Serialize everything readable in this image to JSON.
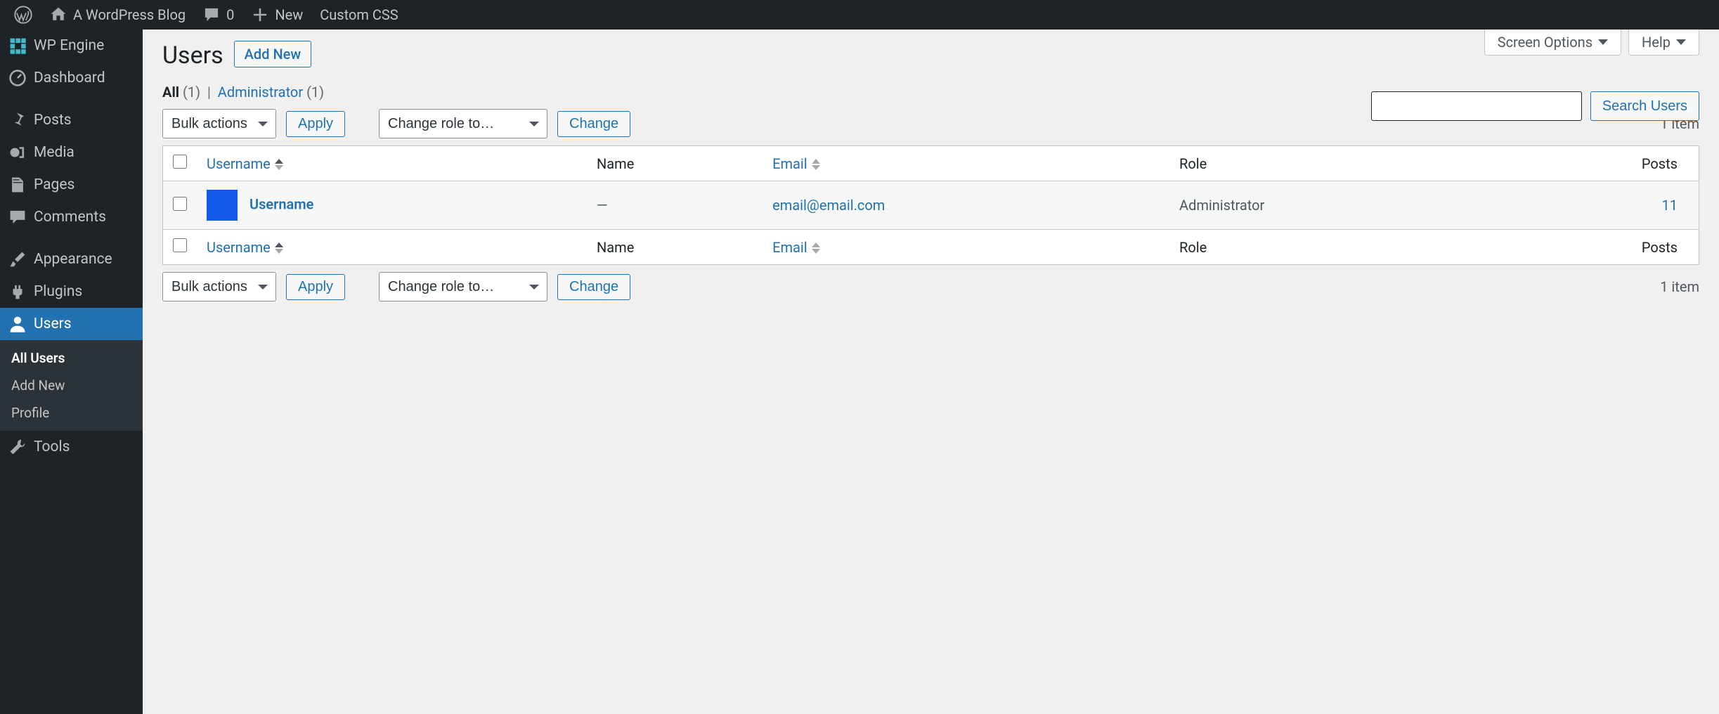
{
  "adminbar": {
    "site_title": "A WordPress Blog",
    "comments_count": "0",
    "new_label": "New",
    "custom_css": "Custom CSS"
  },
  "menu": {
    "wpengine": "WP Engine",
    "dashboard": "Dashboard",
    "posts": "Posts",
    "media": "Media",
    "pages": "Pages",
    "comments": "Comments",
    "appearance": "Appearance",
    "plugins": "Plugins",
    "users": "Users",
    "tools": "Tools",
    "users_sub": {
      "all": "All Users",
      "add": "Add New",
      "profile": "Profile"
    }
  },
  "screen_meta": {
    "screen_options": "Screen Options",
    "help": "Help"
  },
  "page": {
    "heading": "Users",
    "add_new": "Add New"
  },
  "filters": {
    "all_label": "All",
    "all_count": "(1)",
    "admin_label": "Administrator",
    "admin_count": "(1)"
  },
  "search": {
    "button": "Search Users"
  },
  "bulk": {
    "bulk_actions": "Bulk actions",
    "apply": "Apply",
    "change_role": "Change role to…",
    "change": "Change"
  },
  "count": "1 item",
  "columns": {
    "username": "Username",
    "name": "Name",
    "email": "Email",
    "role": "Role",
    "posts": "Posts"
  },
  "rows": [
    {
      "username": "Username",
      "name": "—",
      "email": "email@email.com",
      "role": "Administrator",
      "posts": "11"
    }
  ]
}
